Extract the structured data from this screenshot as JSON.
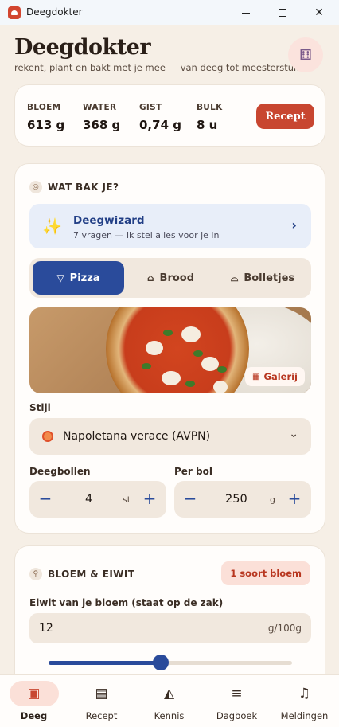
{
  "window": {
    "title": "Deegdokter",
    "minimize_glyph": "—",
    "maximize_glyph": "☐",
    "close_glyph": "✕"
  },
  "header": {
    "title": "Deegdokter",
    "subtitle": "rekent, plant en bakt met je mee — van deeg tot meesterstuk",
    "randomize_icon": "dice-icon"
  },
  "summary": {
    "stats": [
      {
        "label": "BLOEM",
        "value": "613 g"
      },
      {
        "label": "WATER",
        "value": "368 g"
      },
      {
        "label": "GIST",
        "value": "0,74 g"
      },
      {
        "label": "BULK",
        "value": "8 u"
      }
    ],
    "recipe_button": "Recept"
  },
  "bake": {
    "heading": "WAT BAK JE?",
    "wizard": {
      "title": "Deegwizard",
      "subtitle": "7 vragen — ik stel alles voor je in"
    },
    "types": [
      {
        "label": "Pizza",
        "icon": "pizza-icon",
        "active": true
      },
      {
        "label": "Brood",
        "icon": "bread-icon",
        "active": false
      },
      {
        "label": "Bolletjes",
        "icon": "rolls-icon",
        "active": false
      }
    ],
    "gallery_button": "Galerij",
    "style_label": "Stijl",
    "style_value": "Napoletana verace (AVPN)",
    "balls_label": "Deegbollen",
    "balls_value": "4",
    "balls_unit": "st",
    "per_ball_label": "Per bol",
    "per_ball_value": "250",
    "per_ball_unit": "g"
  },
  "flour": {
    "heading": "BLOEM & EIWIT",
    "badge": "1 soort bloem",
    "protein_label": "Eiwit van je bloem (staat op de zak)",
    "protein_value": "12",
    "protein_unit": "g/100g",
    "protein_slider_fraction": 0.46
  },
  "nav": [
    {
      "label": "Deeg",
      "icon": "calculator-icon",
      "active": true
    },
    {
      "label": "Recept",
      "icon": "book-icon",
      "active": false
    },
    {
      "label": "Kennis",
      "icon": "graduation-cap-icon",
      "active": false
    },
    {
      "label": "Dagboek",
      "icon": "journal-icon",
      "active": false
    },
    {
      "label": "Meldingen",
      "icon": "bell-icon",
      "active": false
    }
  ],
  "colors": {
    "accent": "#c84630",
    "primary": "#2a4b9b",
    "background": "#f6efe6"
  }
}
